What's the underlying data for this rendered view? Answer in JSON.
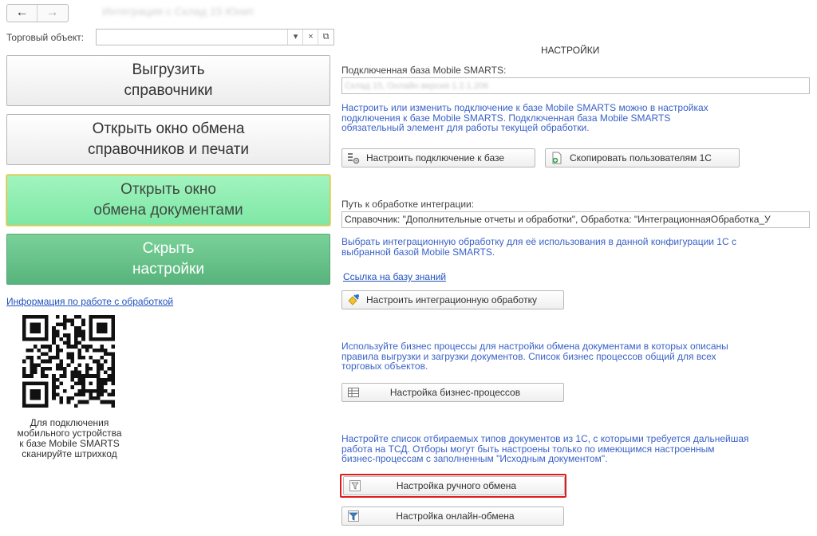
{
  "nav": {
    "back": "←",
    "forward": "→"
  },
  "window": {
    "title": "Интеграция с Склад 15 Юнит"
  },
  "trade": {
    "label": "Торговый объект:",
    "value": "",
    "drop": "▾",
    "clear": "×",
    "open": "⧉"
  },
  "left": {
    "buttons": [
      {
        "line1": "Выгрузить",
        "line2": "справочники"
      },
      {
        "line1": "Открыть окно обмена",
        "line2": "справочников и печати"
      },
      {
        "line1": "Открыть окно",
        "line2": "обмена документами"
      },
      {
        "line1": "Скрыть",
        "line2": "настройки"
      }
    ],
    "info_link": "Информация по работе с обработкой",
    "qr_caption": [
      "Для подключения",
      "мобильного устройства",
      "к базе Mobile SMARTS",
      "сканируйте штрихкод"
    ]
  },
  "right": {
    "heading": "НАСТРОЙКИ",
    "db_label": "Подключенная база Mobile SMARTS:",
    "db_value": "Склад 15, Онлайн версия 1.2.1.206",
    "db_hint": [
      "Настроить или изменить подключение к базе Mobile SMARTS можно в настройках",
      "подключения к базе Mobile SMARTS. Подключенная база Mobile SMARTS",
      "обязательный элемент для работы текущей обработки."
    ],
    "btn_connect": "Настроить подключение к базе",
    "btn_copy_users": "Скопировать пользователям 1С",
    "path_label": "Путь к обработке интеграции:",
    "path_value": "Справочник: \"Дополнительные отчеты и обработки\", Обработка: \"ИнтеграционнаяОбработка_У",
    "integ_hint": [
      "Выбрать интеграционную обработку для её использования в данной конфигурации 1С с",
      "выбранной базой Mobile SMARTS."
    ],
    "kb_link": "Ссылка на базу знаний",
    "btn_integration": "Настроить интеграционную обработку",
    "bp_hint": [
      "Используйте бизнес процессы для настройки обмена документами в которых описаны",
      "правила выгрузки и загрузки документов. Список бизнес процессов общий для всех",
      "торговых объектов."
    ],
    "btn_bp": "Настройка бизнес-процессов",
    "manual_hint": [
      "Настройте список отбираемых типов документов из 1С, с которыми требуется дальнейшая",
      "работа на ТСД. Отборы могут быть настроены только по имеющимся настроенным",
      "бизнес-процессам с заполненным \"Исходным документом\"."
    ],
    "btn_manual": "Настройка ручного обмена",
    "btn_online": "Настройка онлайн-обмена"
  },
  "colors": {
    "link": "#2252bd",
    "hint": "#3a62c7",
    "highlight": "#e01b1b",
    "green_light": "#8ef0b1",
    "green_dark": "#63bf87"
  }
}
